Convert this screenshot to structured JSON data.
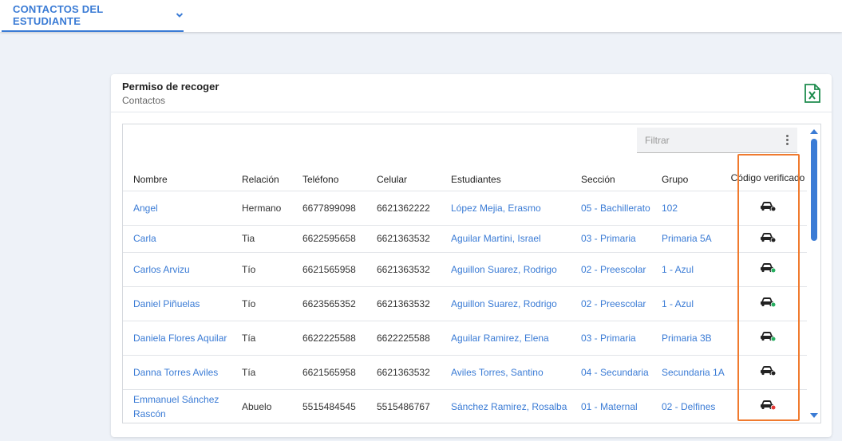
{
  "nav": {
    "tab_label": "CONTACTOS DEL ESTUDIANTE"
  },
  "card": {
    "title": "Permiso de recoger",
    "subtitle": "Contactos",
    "excel_icon": "excel-export-icon"
  },
  "filter": {
    "placeholder": "Filtrar"
  },
  "table": {
    "headers": [
      "Nombre",
      "Relación",
      "Teléfono",
      "Celular",
      "Estudiantes",
      "Sección",
      "Grupo",
      "Código verificado"
    ],
    "rows": [
      {
        "nombre": "Angel",
        "relacion": "Hermano",
        "telefono": "6677899098",
        "celular": "6621362222",
        "estudiantes": "López Mejia, Erasmo",
        "seccion": "05 - Bachillerato",
        "grupo": "102",
        "estado": "pending",
        "h": 43
      },
      {
        "nombre": "Carla",
        "relacion": "Tia",
        "telefono": "6622595658",
        "celular": "6621363532",
        "estudiantes": "Aguilar Martini, Israel",
        "seccion": "03 - Primaria",
        "grupo": "Primaria 5A",
        "estado": "pending",
        "h": 34
      },
      {
        "nombre": "Carlos Arvizu",
        "relacion": "Tío",
        "telefono": "6621565958",
        "celular": "6621363532",
        "estudiantes": "Aguillon Suarez, Rodrigo",
        "seccion": "02 - Preescolar",
        "grupo": "1 - Azul",
        "estado": "verified",
        "h": 43
      },
      {
        "nombre": "Daniel Piñuelas",
        "relacion": "Tío",
        "telefono": "6623565352",
        "celular": "6621363532",
        "estudiantes": "Aguillon Suarez, Rodrigo",
        "seccion": "02 - Preescolar",
        "grupo": "1 - Azul",
        "estado": "verified",
        "h": 43
      },
      {
        "nombre": "Daniela Flores Aquilar",
        "relacion": "Tía",
        "telefono": "6622225588",
        "celular": "6622225588",
        "estudiantes": "Aguilar Ramirez, Elena",
        "seccion": "03 - Primaria",
        "grupo": "Primaria 3B",
        "estado": "verified",
        "h": 43
      },
      {
        "nombre": "Danna Torres Aviles",
        "relacion": "Tía",
        "telefono": "6621565958",
        "celular": "6621363532",
        "estudiantes": "Aviles Torres, Santino",
        "seccion": "04 - Secundaria",
        "grupo": "Secundaria 1A",
        "estado": "pending",
        "h": 43
      },
      {
        "nombre": "Emmanuel Sánchez Rascón",
        "relacion": "Abuelo",
        "telefono": "5515484545",
        "celular": "5515486767",
        "estudiantes": "Sánchez Ramirez, Rosalba",
        "seccion": "01 - Maternal",
        "grupo": "02 - Delfines",
        "estado": "rejected",
        "h": 43
      }
    ]
  },
  "colors": {
    "accent": "#3a7bd5",
    "highlight": "#f07a2e",
    "status_pending": "#222222",
    "status_verified": "#27ae60",
    "status_rejected": "#e53935"
  },
  "icons": {
    "verification": "car-icon",
    "menu": "more-vert-icon",
    "dropdown": "chevron-down-icon"
  }
}
